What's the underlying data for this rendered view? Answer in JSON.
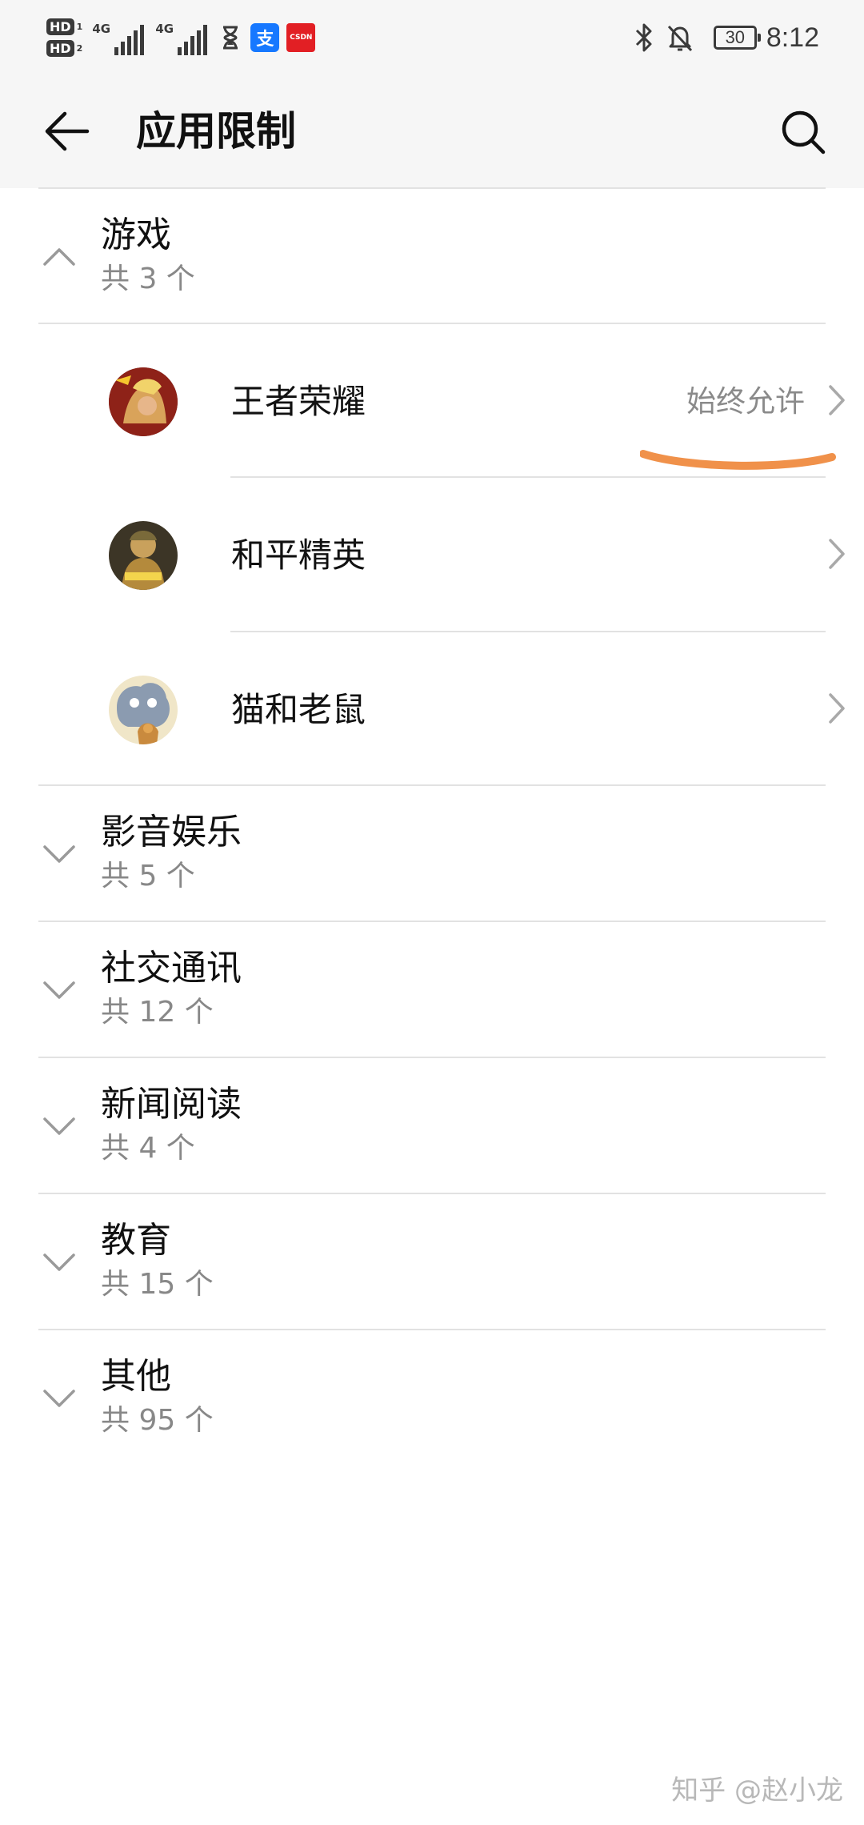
{
  "status_bar": {
    "hd1": "HD",
    "hd1_sub": "1",
    "hd2": "HD",
    "hd2_sub": "2",
    "network1": "4G",
    "network2": "4G",
    "alipay_glyph": "支",
    "csdn_label": "CSDN",
    "battery": "30",
    "time": "8:12"
  },
  "header": {
    "title": "应用限制"
  },
  "groups": [
    {
      "name": "游戏",
      "count": "共 3 个",
      "expanded": true,
      "apps": [
        {
          "name": "王者荣耀",
          "status": "始终允许"
        },
        {
          "name": "和平精英",
          "status": ""
        },
        {
          "name": "猫和老鼠",
          "status": ""
        }
      ]
    },
    {
      "name": "影音娱乐",
      "count": "共 5 个",
      "expanded": false
    },
    {
      "name": "社交通讯",
      "count": "共 12 个",
      "expanded": false
    },
    {
      "name": "新闻阅读",
      "count": "共 4 个",
      "expanded": false
    },
    {
      "name": "教育",
      "count": "共 15 个",
      "expanded": false
    },
    {
      "name": "其他",
      "count": "共 95 个",
      "expanded": false
    }
  ],
  "watermark": "知乎 @赵小龙",
  "colors": {
    "annotation": "#f0914a",
    "secondary_text": "#888888",
    "divider": "#e2e2e2",
    "bar_background": "#f6f6f6"
  }
}
